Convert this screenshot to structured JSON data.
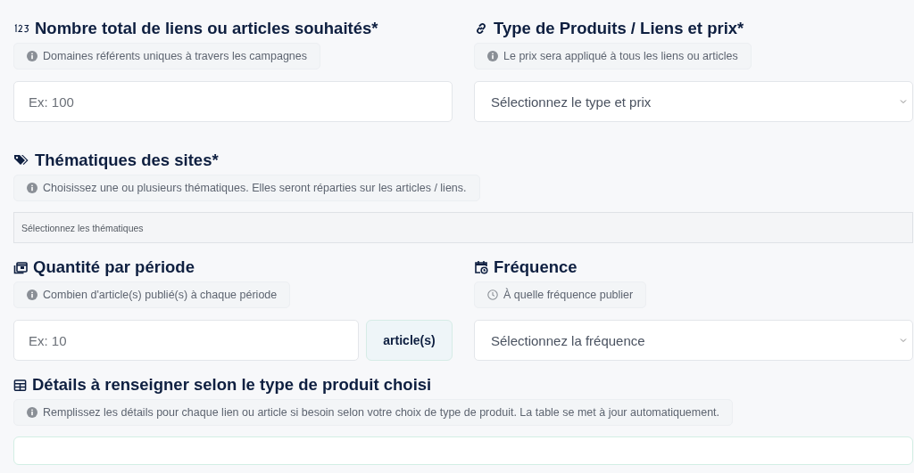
{
  "rows": [
    [
      {
        "title": "Nombre total de liens ou articles souhaités*",
        "hint": "Domaines référents uniques à travers les campagnes",
        "field": {
          "kind": "input",
          "placeholder": "Ex: 100"
        }
      },
      {
        "title": "Type de Produits / Liens et prix*",
        "hint": "Le prix sera appliqué à tous les liens ou articles",
        "field": {
          "kind": "select",
          "value": "Sélectionnez le type et prix"
        }
      }
    ],
    [
      {
        "title": "Thématiques des sites*",
        "hint": "Choisissez une ou plusieurs thématiques. Elles seront réparties sur les articles / liens.",
        "field": {
          "kind": "multiselect",
          "placeholder": "Sélectionnez les thématiques"
        }
      }
    ],
    [
      {
        "title": "Quantité par période",
        "hint": "Combien d'article(s) publié(s) à chaque période",
        "field": {
          "kind": "addon_input",
          "placeholder": "Ex: 10",
          "addon": "article(s)"
        }
      },
      {
        "title": "Fréquence",
        "hint": "À quelle fréquence publier",
        "field": {
          "kind": "select",
          "value": "Sélectionnez la fréquence"
        }
      }
    ],
    [
      {
        "title": "Détails à renseigner selon le type de produit choisi",
        "hint": "Remplissez les détails pour chaque lien ou article si besoin selon votre choix de type de produit. La table se met à jour automatiquement.",
        "field": {
          "kind": "table"
        }
      }
    ]
  ]
}
